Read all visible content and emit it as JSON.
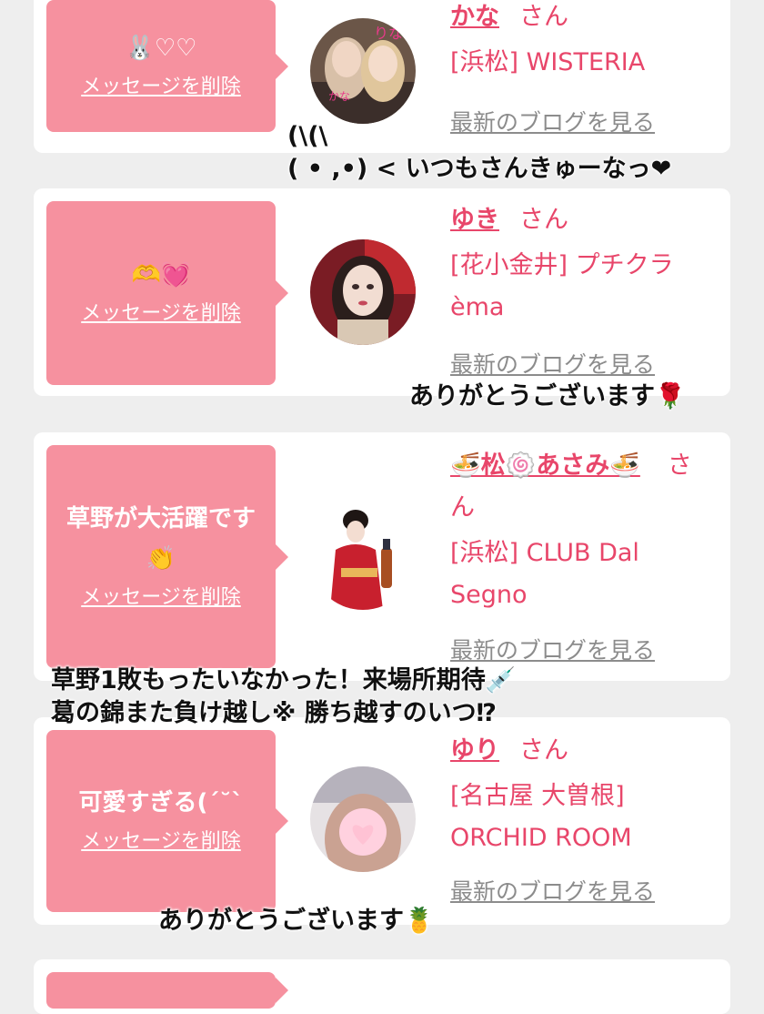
{
  "delete_label": "メッセージを削除",
  "blog_label": "最新のブログを見る",
  "san_label": "さん",
  "cards": [
    {
      "message": "🐰♡♡",
      "name": "かな",
      "shop": "[浜松] WISTERIA"
    },
    {
      "message": "🫶💓",
      "name": "ゆき",
      "shop": "[花小金井] プチクラèma"
    },
    {
      "message": "草野が大活躍です",
      "message2": "👏",
      "name": "🍜松🍥あさみ🍜",
      "shop": "[浜松] CLUB Dal Segno"
    },
    {
      "message": "可愛すぎる(ˊ˘ˋ",
      "name": "ゆり",
      "shop": "[名古屋 大曽根] ORCHID ROOM"
    }
  ],
  "overlays": {
    "kana_line1": "(\\(\\",
    "kana_line2": "( • ,•) < いつもさんきゅーなっ❤",
    "yuki": "ありがとうございます🌹",
    "asami_line1": "草野1敗もったいなかった！来場所期待💉",
    "asami_line2": "葛の錦また負け越し※ 勝ち越すのいつ⁉",
    "yuri": "ありがとうございます🍍"
  },
  "colors": {
    "accent": "#e8466a",
    "bubble": "#f6919f",
    "link_gray": "#8c8c8c"
  }
}
